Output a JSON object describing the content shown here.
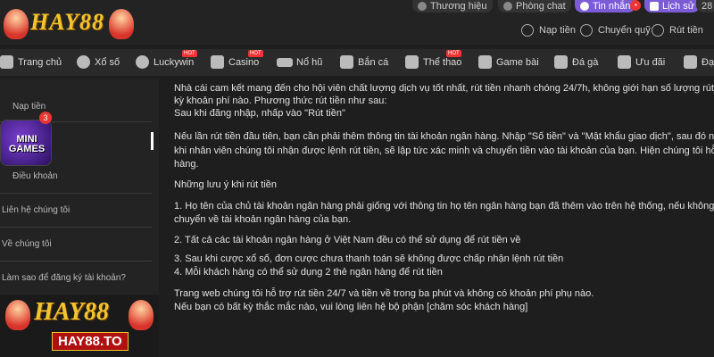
{
  "header": {
    "logo_text": "HAY88",
    "top_tabs": [
      {
        "label": "Thương hiệu"
      },
      {
        "label": "Phòng chat"
      },
      {
        "label": "Tin nhắn",
        "badge": "•"
      },
      {
        "label": "Lịch sử"
      },
      {
        "label": "28"
      }
    ],
    "actions": [
      {
        "label": "Nạp tiền"
      },
      {
        "label": "Chuyển quỹ"
      },
      {
        "label": "Rút tiền"
      }
    ]
  },
  "nav": {
    "items": [
      {
        "label": "Trang chủ",
        "icon": "home-icon"
      },
      {
        "label": "Xổ số",
        "icon": "lottery-icon"
      },
      {
        "label": "Luckywin",
        "icon": "ball-icon",
        "hot": "HOT"
      },
      {
        "label": "Casino",
        "icon": "casino-icon",
        "hot": "HOT"
      },
      {
        "label": "Nổ hũ",
        "icon": "slot-icon"
      },
      {
        "label": "Bắn cá",
        "icon": "fish-icon"
      },
      {
        "label": "Thể thao",
        "icon": "sport-icon",
        "hot": "HOT"
      },
      {
        "label": "Game bài",
        "icon": "cards-icon"
      },
      {
        "label": "Đá gà",
        "icon": "rooster-icon"
      },
      {
        "label": "Ưu đãi",
        "icon": "gift-icon"
      },
      {
        "label": "Đại",
        "icon": "agent-icon"
      }
    ]
  },
  "sidebar": {
    "items": [
      {
        "label": "Nạp tiền"
      },
      {
        "label": "Điều khoản"
      },
      {
        "label": "Liên hệ chúng tôi"
      },
      {
        "label": "Về chúng tôi"
      },
      {
        "label": "Làm sao để đăng ký tài khoản?"
      }
    ],
    "mini_games": {
      "line1": "MINI",
      "line2": "GAMES",
      "badge": "3"
    },
    "bottom_logo": {
      "brand": "HAY88",
      "domain": "HAY88.TO"
    }
  },
  "content": {
    "lines": [
      "Nhà cái cam kết mang đến cho hội viên chất lượng dịch vụ tốt nhất, rút tiền nhanh chóng 24/7h, không giới hạn số lượng rút. Khô",
      "kỳ khoản phí nào. Phương thức rút tiền như sau:",
      "Sau khi đăng nhập, nhấp vào \"Rút tiền\"",
      "Nếu lần rút tiền đầu tiên, bạn cần phải thêm thông tin tài khoản ngân hàng. Nhập \"Số tiền\" và \"Mật khẩu giao dịch\", sau đó nhấp v",
      "khi nhân viên chúng tôi nhận được lệnh rút tiền, sẽ lập tức xác minh và chuyển tiền vào tài khoản của bạn. Hiện chúng tôi hỗ trợ",
      "hàng.",
      "Những lưu ý khi rút tiền",
      "1. Họ tên của chủ tài khoản ngân hàng phải giống với thông tin họ tên ngân hàng bạn đã thêm vào trên hệ thống, nếu không, số ti",
      "chuyển về tài khoản ngân hàng của bạn.",
      "2. Tất cả các tài khoản ngân hàng ở Việt Nam đều có thể sử dụng để rút tiền về",
      "3. Sau khi cược xổ số, đơn cược chưa thanh toán sẽ không được chấp nhận lệnh rút tiền",
      "4. Mỗi khách hàng có thể sử dụng 2 thẻ ngân hàng để rút tiền",
      "Trang web chúng tôi hỗ trợ rút tiền 24/7 và tiền về trong ba phút và không có khoản phí phụ nào.",
      "Nếu bạn có bất kỳ thắc mắc nào, vui lòng liên hệ bộ phận [chăm sóc khách hàng]"
    ]
  },
  "colors": {
    "accent": "#7c5cd6",
    "brand_gold": "#f4c430",
    "bg": "#1e1e1e"
  }
}
